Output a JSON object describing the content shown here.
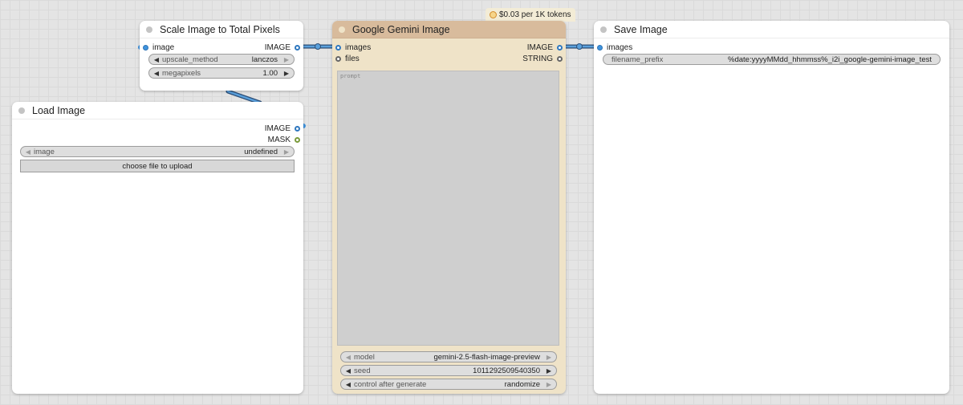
{
  "colors": {
    "canvas": "#e4e4e4",
    "node_bg": "#ffffff",
    "gemini_header": "#d8bb9c",
    "gemini_body": "#efe3c8",
    "link_image": "#5aa0dc",
    "widget_bg": "#dedede"
  },
  "nodes": {
    "scale": {
      "title": "Scale Image to Total Pixels",
      "input_image": "image",
      "output_image": "IMAGE",
      "upscale_method": {
        "label": "upscale_method",
        "value": "lanczos"
      },
      "megapixels": {
        "label": "megapixels",
        "value": "1.00"
      }
    },
    "load": {
      "title": "Load Image",
      "output_image": "IMAGE",
      "output_mask": "MASK",
      "image_widget": {
        "label": "image",
        "value": "undefined"
      },
      "upload_button": "choose file to upload"
    },
    "gemini": {
      "title": "Google Gemini Image",
      "price_badge": "$0.03 per 1K tokens",
      "input_images": "images",
      "input_files": "files",
      "output_image": "IMAGE",
      "output_string": "STRING",
      "prompt_placeholder": "prompt",
      "model": {
        "label": "model",
        "value": "gemini-2.5-flash-image-preview"
      },
      "seed": {
        "label": "seed",
        "value": "1011292509540350"
      },
      "control": {
        "label": "control after generate",
        "value": "randomize"
      }
    },
    "save": {
      "title": "Save Image",
      "input_images": "images",
      "filename_prefix": {
        "label": "filename_prefix",
        "value": "%date:yyyyMMdd_hhmmss%_i2i_google-gemini-image_test"
      }
    }
  },
  "icons": {
    "left_arrow": "◀",
    "right_arrow": "▶",
    "title_dot": "status-dot",
    "coin": "coin-icon"
  }
}
